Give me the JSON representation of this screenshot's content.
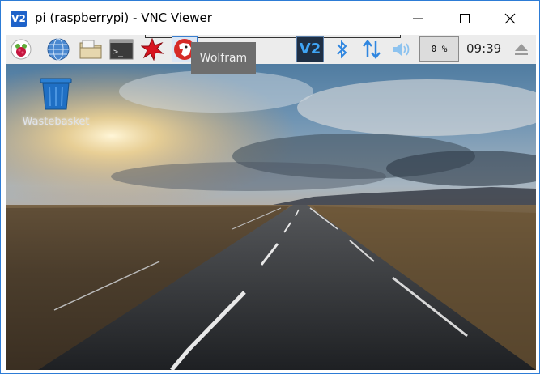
{
  "window": {
    "title": "pi (raspberrypi) - VNC Viewer",
    "app_icon_text": "V2"
  },
  "panel": {
    "launchers": [
      "raspberry-menu-icon",
      "web-browser-icon",
      "file-manager-icon",
      "terminal-icon",
      "mathematica-icon",
      "wolfram-icon"
    ],
    "tooltip": "Wolfram",
    "vnc_tray_text": "V2",
    "cpu_usage": "0 %",
    "clock": "09:39"
  },
  "desktop": {
    "icons": [
      {
        "label": "Wastebasket",
        "icon": "wastebasket-icon"
      }
    ]
  },
  "colors": {
    "window_border": "#2d7cd6",
    "panel_bg": "#ececec",
    "tray_blue": "#3fa4f5",
    "tooltip_bg": "#6e6e6e"
  }
}
